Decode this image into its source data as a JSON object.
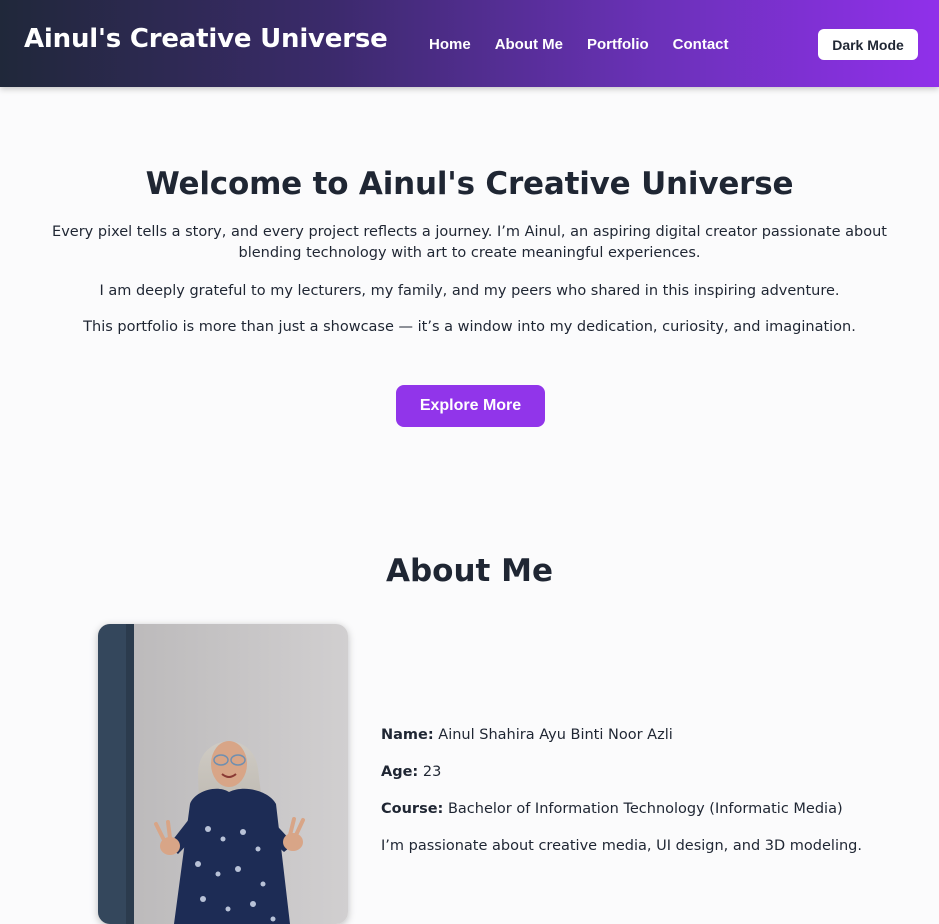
{
  "header": {
    "brand": "Ainul's Creative Universe",
    "nav": [
      "Home",
      "About Me",
      "Portfolio",
      "Contact"
    ],
    "dark_mode_label": "Dark Mode"
  },
  "hero": {
    "title": "Welcome to Ainul's Creative Universe",
    "paragraphs": [
      "Every pixel tells a story, and every project reflects a journey. I’m Ainul, an aspiring digital creator passionate about blending technology with art to create meaningful experiences.",
      "I am deeply grateful to my lecturers, my family, and my peers who shared in this inspiring adventure.",
      "This portfolio is more than just a showcase — it’s a window into my dedication, curiosity, and imagination."
    ],
    "cta_label": "Explore More"
  },
  "about": {
    "title": "About Me",
    "name_label": "Name:",
    "name_value": "Ainul Shahira Ayu Binti Noor Azli",
    "age_label": "Age:",
    "age_value": "23",
    "course_label": "Course:",
    "course_value": "Bachelor of Information Technology (Informatic Media)",
    "bio": "I’m passionate about creative media, UI design, and 3D modeling."
  },
  "colors": {
    "accent": "#9135ea",
    "header_start": "#20283a",
    "header_end": "#9030ea",
    "text": "#1f2633",
    "background": "#fbfbfc"
  }
}
